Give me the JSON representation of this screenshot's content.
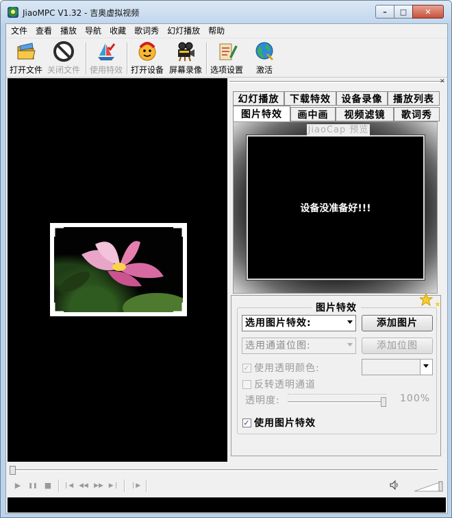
{
  "window": {
    "title": "JiaoMPC V1.32 - 吉奥虚拟视频",
    "controls": {
      "minimize": "–",
      "maximize": "□",
      "close": "✕"
    }
  },
  "menu": [
    "文件",
    "查看",
    "播放",
    "导航",
    "收藏",
    "歌词秀",
    "幻灯播放",
    "帮助"
  ],
  "toolbar": {
    "open_file": "打开文件",
    "close_file": "关闭文件",
    "use_effect": "使用特效",
    "open_device": "打开设备",
    "screen_record": "屏幕录像",
    "options": "选项设置",
    "activate": "激活"
  },
  "tabs": {
    "row1": [
      "幻灯播放",
      "下载特效",
      "设备录像",
      "播放列表"
    ],
    "row2": [
      "图片特效",
      "画中画",
      "视频滤镜",
      "歌词秀"
    ],
    "active": "图片特效"
  },
  "preview": {
    "caption": "JiaoCap 预览",
    "message": "设备没准备好!!!"
  },
  "effects": {
    "group_title": "图片特效",
    "select_effect": "选用图片特效:",
    "add_image": "添加图片",
    "select_channel": "选用通道位图:",
    "add_bitmap": "添加位图",
    "use_transparent_color": "使用透明颜色:",
    "invert_alpha": "反转透明通道",
    "transparency_label": "透明度:",
    "transparency_value": "100%",
    "transparency_level": 1.0,
    "use_image_effect": "使用图片特效",
    "use_transparent_color_checked": true,
    "invert_alpha_checked": false,
    "use_image_effect_checked": true
  },
  "playback": {
    "play": "▶",
    "pause": "❚❚",
    "stop": "■",
    "prev": "❘◀",
    "rewind": "◀◀",
    "forward": "▶▶",
    "next": "▶❘",
    "step": "❘▶",
    "volume_icon": "speaker-icon",
    "seek_position": 0
  },
  "colors": {
    "video_bg": "#000000",
    "window_frame": "#bcd3ea",
    "client_bg": "#f0f0f0"
  }
}
